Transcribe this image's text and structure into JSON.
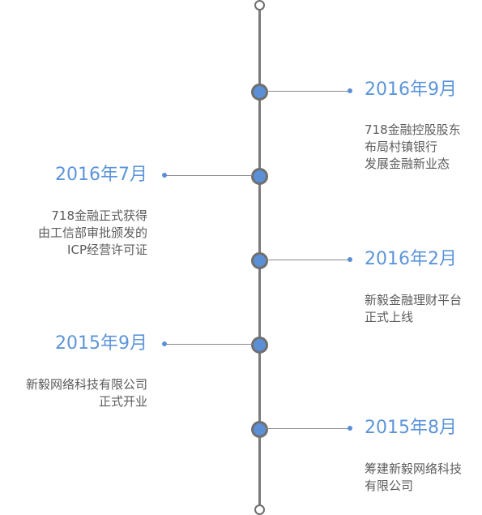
{
  "timeline": {
    "events": [
      {
        "date": "2016年9月",
        "side": "right",
        "lines": [
          "718金融控股股东",
          "布局村镇银行",
          "发展金融新业态"
        ]
      },
      {
        "date": "2016年7月",
        "side": "left",
        "lines": [
          "718金融正式获得",
          "由工信部审批颁发的",
          "ICP经营许可证"
        ]
      },
      {
        "date": "2016年2月",
        "side": "right",
        "lines": [
          "新毅金融理财平台",
          "正式上线"
        ]
      },
      {
        "date": "2015年9月",
        "side": "left",
        "lines": [
          "新毅网络科技有限公司",
          "正式开业"
        ]
      },
      {
        "date": "2015年8月",
        "side": "right",
        "lines": [
          "筹建新毅网络科技",
          "有限公司"
        ]
      }
    ]
  },
  "colors": {
    "accent": "#5d95da",
    "axis": "#7a7a7a",
    "text": "#5c5c5c"
  }
}
